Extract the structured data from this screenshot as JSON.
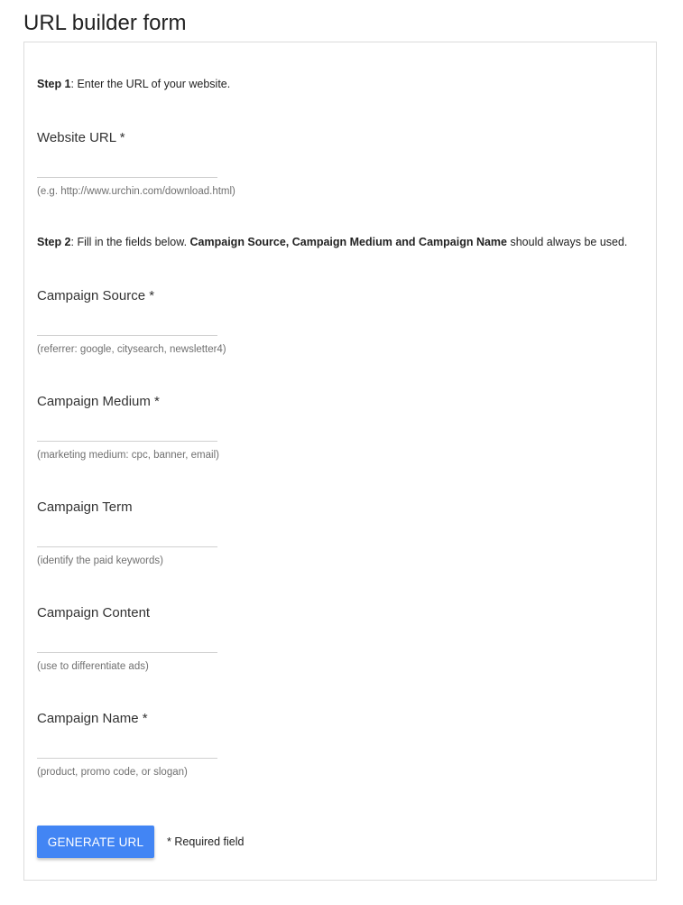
{
  "page": {
    "title": "URL builder form"
  },
  "step1": {
    "label": "Step 1",
    "text": ": Enter the URL of your website."
  },
  "step2": {
    "label": "Step 2",
    "text_before": ": Fill in the fields below. ",
    "emphasis": "Campaign Source, Campaign Medium and Campaign Name",
    "text_after": " should always be used."
  },
  "fields": {
    "website_url": {
      "label": "Website URL *",
      "value": "",
      "hint": "(e.g. http://www.urchin.com/download.html)"
    },
    "campaign_source": {
      "label": "Campaign Source *",
      "value": "",
      "hint": "(referrer: google, citysearch, newsletter4)"
    },
    "campaign_medium": {
      "label": "Campaign Medium *",
      "value": "",
      "hint": "(marketing medium: cpc, banner, email)"
    },
    "campaign_term": {
      "label": "Campaign Term",
      "value": "",
      "hint": "(identify the paid keywords)"
    },
    "campaign_content": {
      "label": "Campaign Content",
      "value": "",
      "hint": "(use to differentiate ads)"
    },
    "campaign_name": {
      "label": "Campaign Name *",
      "value": "",
      "hint": "(product, promo code, or slogan)"
    }
  },
  "actions": {
    "generate_label": "GENERATE URL",
    "required_note": "* Required field"
  },
  "colors": {
    "button_bg": "#4285f4",
    "button_text": "#ffffff",
    "border": "#dcdcdc"
  }
}
